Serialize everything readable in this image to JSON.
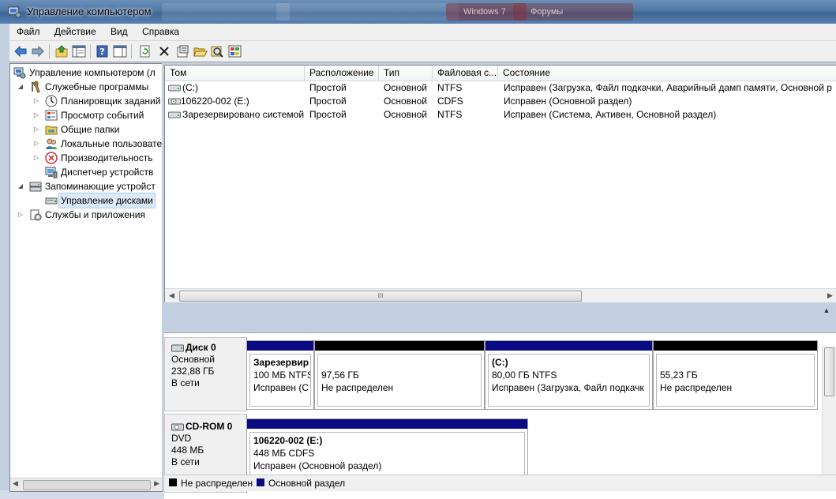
{
  "window": {
    "title": "Управление компьютером",
    "background_tabs": [
      "​",
      "​",
      "Windows 7",
      "Форумы"
    ]
  },
  "menu": [
    "Файл",
    "Действие",
    "Вид",
    "Справка"
  ],
  "toolbar": {
    "icons": [
      "back-icon",
      "forward-icon",
      "up-folder-icon",
      "show-console-tree-icon",
      "help-icon",
      "show-action-pane-icon",
      "refresh-icon",
      "delete-icon",
      "properties-icon",
      "open-icon",
      "search-icon",
      "settings-icon"
    ]
  },
  "tree": {
    "root": "Управление компьютером (л",
    "items": [
      {
        "label": "Служебные программы",
        "level": 1,
        "expanded": true
      },
      {
        "label": "Планировщик заданий",
        "level": 2,
        "expanded": false
      },
      {
        "label": "Просмотр событий",
        "level": 2,
        "expanded": false
      },
      {
        "label": "Общие папки",
        "level": 2,
        "expanded": false
      },
      {
        "label": "Локальные пользовате",
        "level": 2,
        "expanded": false
      },
      {
        "label": "Производительность",
        "level": 2,
        "expanded": false
      },
      {
        "label": "Диспетчер устройств",
        "level": 2,
        "expanded": null
      },
      {
        "label": "Запоминающие устройст",
        "level": 1,
        "expanded": true
      },
      {
        "label": "Управление дисками",
        "level": 2,
        "expanded": null,
        "selected": true
      },
      {
        "label": "Службы и приложения",
        "level": 1,
        "expanded": false
      }
    ]
  },
  "volumes": {
    "columns": [
      "Том",
      "Расположение",
      "Тип",
      "Файловая с...",
      "Состояние"
    ],
    "rows": [
      {
        "name": "(C:)",
        "layout": "Простой",
        "type": "Основной",
        "fs": "NTFS",
        "status": "Исправен (Загрузка, Файл подкачки, Аварийный дамп памяти, Основной р"
      },
      {
        "name": "106220-002 (E:)",
        "layout": "Простой",
        "type": "Основной",
        "fs": "CDFS",
        "status": "Исправен (Основной раздел)"
      },
      {
        "name": "Зарезервировано системой",
        "layout": "Простой",
        "type": "Основной",
        "fs": "NTFS",
        "status": "Исправен (Система, Активен, Основной раздел)"
      }
    ],
    "scroll_thumb_glyph": "III"
  },
  "disks": [
    {
      "name": "Диск 0",
      "kind": "Основной",
      "size": "232,88 ГБ",
      "state": "В сети",
      "partitions": [
        {
          "title": "Зарезервир",
          "line2": "100 МБ NTFS",
          "line3": "Исправен (С",
          "color": "#0a0a82",
          "title_bold": true
        },
        {
          "title": "",
          "line2": "97,56 ГБ",
          "line3": "Не распределен",
          "color": "#000000",
          "title_bold": false
        },
        {
          "title": " (C:)",
          "line2": "80,00 ГБ NTFS",
          "line3": "Исправен (Загрузка, Файл подкачк",
          "color": "#0a0a82",
          "title_bold": true
        },
        {
          "title": "",
          "line2": "55,23 ГБ",
          "line3": "Не распределен",
          "color": "#000000",
          "title_bold": false
        }
      ]
    },
    {
      "name": "CD-ROM 0",
      "kind": "DVD",
      "size": "448 МБ",
      "state": "В сети",
      "partitions": [
        {
          "title": "106220-002  (E:)",
          "line2": "448 МБ CDFS",
          "line3": "Исправен (Основной раздел)",
          "color": "#0a0a82",
          "title_bold": true
        }
      ]
    }
  ],
  "legend": [
    {
      "label": "Не распределен",
      "color": "#000000"
    },
    {
      "label": "Основной раздел",
      "color": "#0a0a82"
    }
  ]
}
